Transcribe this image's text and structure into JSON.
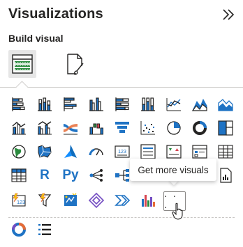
{
  "pane": {
    "title": "Visualizations",
    "collapse_icon": "double-chevron-right-icon",
    "subtitle": "Build visual"
  },
  "modes": [
    {
      "name": "build-visual",
      "icon": "table-fields-icon",
      "active": true
    },
    {
      "name": "format-visual",
      "icon": "paintbrush-page-icon",
      "active": false
    }
  ],
  "text_icons": {
    "r": "R",
    "python": "Py"
  },
  "more_button": {
    "label": "· · ·"
  },
  "tooltip": {
    "text": "Get more visuals"
  },
  "colors": {
    "blue": "#1F73C4",
    "accent": "#118DFF",
    "green": "#2B8A3E",
    "yellow": "#F2C80F",
    "orange": "#E66C37",
    "red": "#D64550",
    "purple": "#744EC2"
  }
}
